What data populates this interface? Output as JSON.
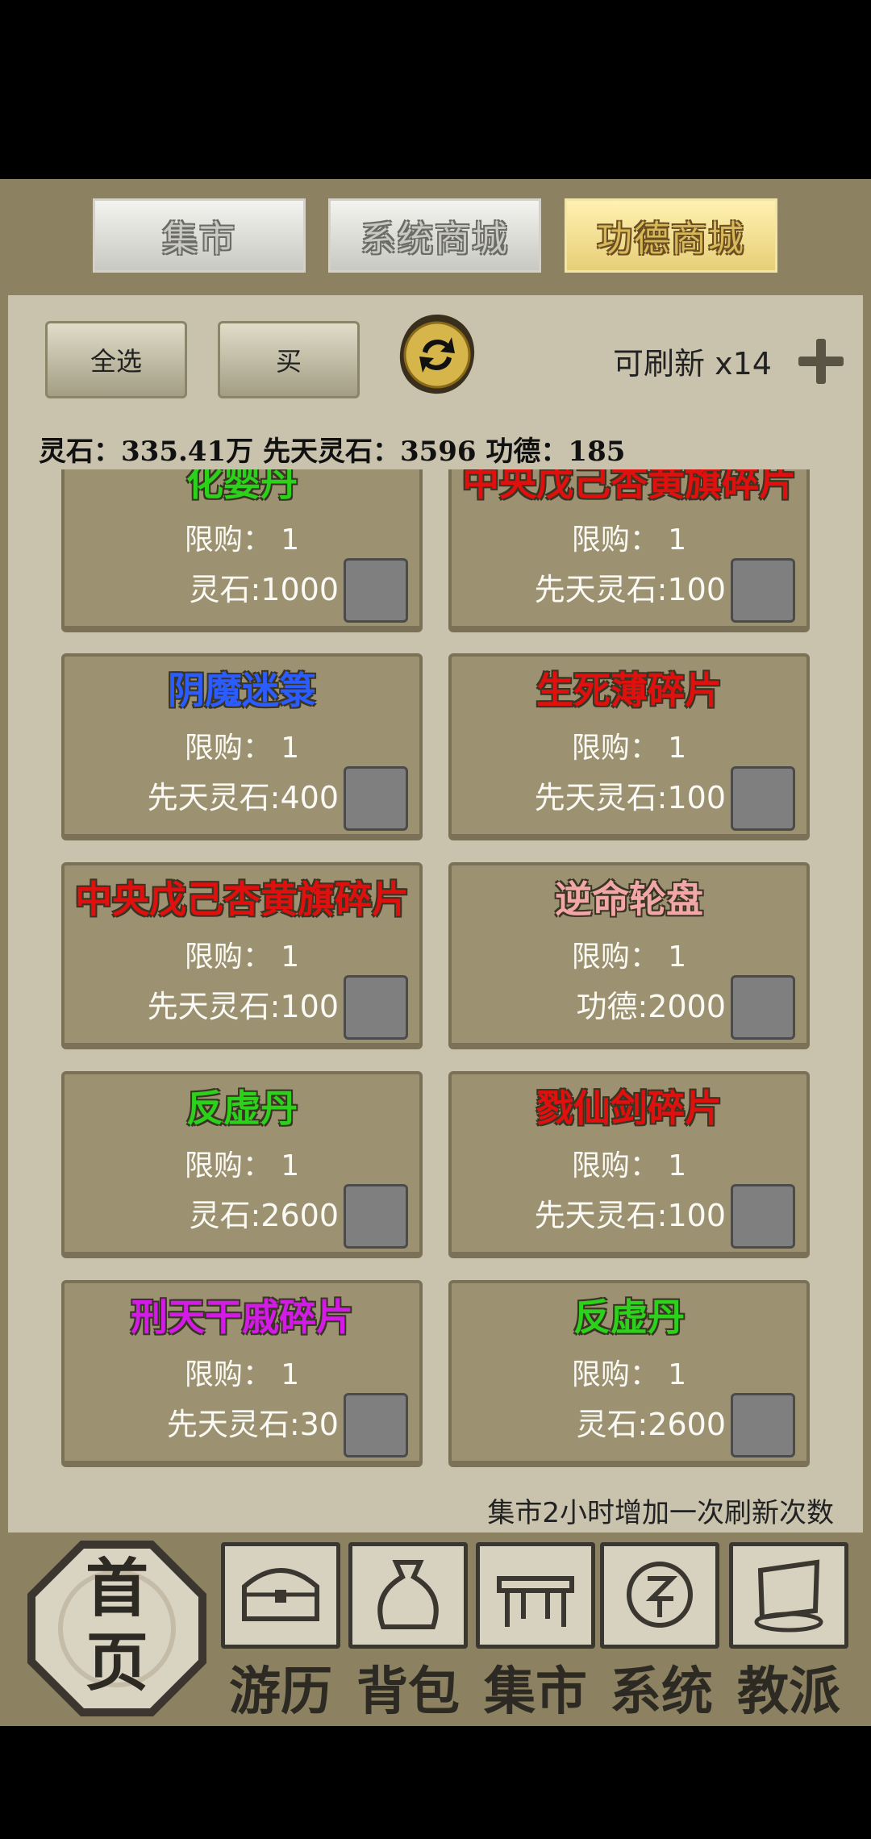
{
  "tabs": [
    {
      "label": "集市",
      "active": false
    },
    {
      "label": "系统商城",
      "active": false
    },
    {
      "label": "功德商城",
      "active": true
    }
  ],
  "toolbar": {
    "select_all": "全选",
    "buy": "买",
    "refresh_label": "可刷新 x14"
  },
  "currency": {
    "text": "灵石：335.41万 先天灵石：3596 功德：185"
  },
  "items": [
    {
      "name": "化婴丹",
      "color": "#2bd11a",
      "limit": "限购： 1",
      "price": "灵石:1000"
    },
    {
      "name": "中央戊己杏黄旗碎片",
      "color": "#e0100e",
      "limit": "限购： 1",
      "price": "先天灵石:100"
    },
    {
      "name": "阴魔迷箓",
      "color": "#2a5cff",
      "limit": "限购： 1",
      "price": "先天灵石:400"
    },
    {
      "name": "生死薄碎片",
      "color": "#e0100e",
      "limit": "限购： 1",
      "price": "先天灵石:100"
    },
    {
      "name": "中央戊己杏黄旗碎片",
      "color": "#e0100e",
      "limit": "限购： 1",
      "price": "先天灵石:100"
    },
    {
      "name": "逆命轮盘",
      "color": "#f2a7a7",
      "limit": "限购： 1",
      "price": "功德:2000"
    },
    {
      "name": "反虚丹",
      "color": "#2bd11a",
      "limit": "限购： 1",
      "price": "灵石:2600"
    },
    {
      "name": "戮仙剑碎片",
      "color": "#e0100e",
      "limit": "限购： 1",
      "price": "先天灵石:100"
    },
    {
      "name": "刑天干戚碎片",
      "color": "#d21ce6",
      "limit": "限购： 1",
      "price": "先天灵石:30"
    },
    {
      "name": "反虚丹",
      "color": "#2bd11a",
      "limit": "限购： 1",
      "price": "灵石:2600"
    }
  ],
  "hint": "集市2小时增加一次刷新次数",
  "nav": {
    "home": "首页",
    "items": [
      {
        "label": "游历",
        "icon": "chest-icon"
      },
      {
        "label": "背包",
        "icon": "bag-icon"
      },
      {
        "label": "集市",
        "icon": "market-stall-icon"
      },
      {
        "label": "系统",
        "icon": "system-seal-icon"
      },
      {
        "label": "教派",
        "icon": "sect-icon"
      }
    ]
  }
}
